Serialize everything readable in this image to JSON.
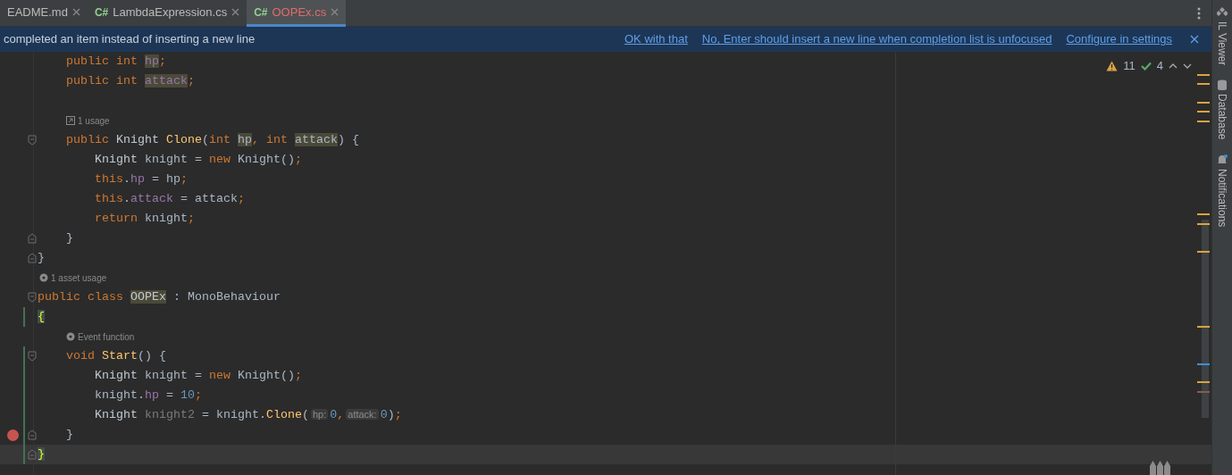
{
  "tabs": [
    {
      "label": "EADME.md",
      "kind": "markdown",
      "selected": false,
      "has_errors": false
    },
    {
      "label": "LambdaExpression.cs",
      "kind": "csharp",
      "icon_text": "C#",
      "selected": false,
      "has_errors": false
    },
    {
      "label": "OOPEx.cs",
      "kind": "csharp",
      "icon_text": "C#",
      "selected": true,
      "has_errors": true
    }
  ],
  "banner": {
    "message": "completed an item instead of inserting a new line",
    "actions": [
      "OK with that",
      "No, Enter should insert a new line when completion list is unfocused",
      "Configure in settings"
    ]
  },
  "inspections": {
    "warnings": "11",
    "passed": "4"
  },
  "editor": {
    "lines": [
      {
        "kind": "code",
        "changed": false,
        "breakpoint": false,
        "current": false,
        "tokens": [
          {
            "t": "    public int ",
            "kind": "kw"
          },
          {
            "t": "hp",
            "kind": "field",
            "hl": true
          },
          {
            "t": ";",
            "kind": "kw"
          }
        ]
      },
      {
        "kind": "code",
        "changed": false,
        "breakpoint": false,
        "current": false,
        "tokens": [
          {
            "t": "    public int ",
            "kind": "kw"
          },
          {
            "t": "attack",
            "kind": "field",
            "hl": true
          },
          {
            "t": ";",
            "kind": "kw"
          }
        ]
      },
      {
        "kind": "blank"
      },
      {
        "kind": "usage-hint",
        "indent": true,
        "text": "1 usage"
      },
      {
        "kind": "fold-start",
        "changed": false,
        "breakpoint": false,
        "current": false,
        "tokens": [
          {
            "t": "    public ",
            "kind": "kw"
          },
          {
            "t": "Knight ",
            "kind": "type"
          },
          {
            "t": "Clone",
            "kind": "method"
          },
          {
            "t": "(",
            "kind": "plain"
          },
          {
            "t": "int ",
            "kind": "kw"
          },
          {
            "t": "hp",
            "kind": "plain",
            "hl": true
          },
          {
            "t": ", ",
            "kind": "kw"
          },
          {
            "t": "int ",
            "kind": "kw"
          },
          {
            "t": "attack",
            "kind": "plain",
            "hl": true
          },
          {
            "t": ") {",
            "kind": "plain"
          }
        ]
      },
      {
        "kind": "code",
        "changed": false,
        "breakpoint": false,
        "current": false,
        "tokens": [
          {
            "t": "        Knight",
            "kind": "type"
          },
          {
            "t": " knight = ",
            "kind": "plain"
          },
          {
            "t": "new",
            "kind": "kw"
          },
          {
            "t": " Knight()",
            "kind": "plain"
          },
          {
            "t": ";",
            "kind": "kw"
          }
        ]
      },
      {
        "kind": "code",
        "changed": false,
        "breakpoint": false,
        "current": false,
        "tokens": [
          {
            "t": "        this",
            "kind": "kw"
          },
          {
            "t": ".",
            "kind": "plain"
          },
          {
            "t": "hp",
            "kind": "field"
          },
          {
            "t": " = hp",
            "kind": "plain"
          },
          {
            "t": ";",
            "kind": "kw"
          }
        ]
      },
      {
        "kind": "code",
        "changed": false,
        "breakpoint": false,
        "current": false,
        "tokens": [
          {
            "t": "        this",
            "kind": "kw"
          },
          {
            "t": ".",
            "kind": "plain"
          },
          {
            "t": "attack",
            "kind": "field"
          },
          {
            "t": " = attack",
            "kind": "plain"
          },
          {
            "t": ";",
            "kind": "kw"
          }
        ]
      },
      {
        "kind": "code",
        "changed": false,
        "breakpoint": false,
        "current": false,
        "tokens": [
          {
            "t": "        return",
            "kind": "kw"
          },
          {
            "t": " knight",
            "kind": "plain"
          },
          {
            "t": ";",
            "kind": "kw"
          }
        ]
      },
      {
        "kind": "fold-end",
        "changed": false,
        "breakpoint": false,
        "current": false,
        "tokens": [
          {
            "t": "    }",
            "kind": "plain"
          }
        ]
      },
      {
        "kind": "fold-end",
        "changed": false,
        "breakpoint": false,
        "current": false,
        "tokens": [
          {
            "t": "}",
            "kind": "plain"
          }
        ]
      },
      {
        "kind": "unity-hint",
        "indent": false,
        "text": "1 asset usage"
      },
      {
        "kind": "fold-start",
        "changed": false,
        "breakpoint": false,
        "current": false,
        "tokens": [
          {
            "t": "public class ",
            "kind": "kw"
          },
          {
            "t": "OOPEx",
            "kind": "type",
            "hl": true
          },
          {
            "t": " : MonoBehaviour",
            "kind": "plain"
          }
        ]
      },
      {
        "kind": "code",
        "changed": true,
        "breakpoint": false,
        "current": false,
        "tokens": [
          {
            "t": "{",
            "kind": "brace"
          }
        ]
      },
      {
        "kind": "unity-hint",
        "indent": true,
        "text": "Event function"
      },
      {
        "kind": "fold-start",
        "changed": true,
        "breakpoint": false,
        "current": false,
        "tokens": [
          {
            "t": "    void ",
            "kind": "kw"
          },
          {
            "t": "Start",
            "kind": "method"
          },
          {
            "t": "() {",
            "kind": "plain"
          }
        ]
      },
      {
        "kind": "code",
        "changed": true,
        "breakpoint": false,
        "current": false,
        "tokens": [
          {
            "t": "        Knight",
            "kind": "type"
          },
          {
            "t": " knight = ",
            "kind": "plain"
          },
          {
            "t": "new",
            "kind": "kw"
          },
          {
            "t": " Knight()",
            "kind": "plain"
          },
          {
            "t": ";",
            "kind": "kw"
          }
        ]
      },
      {
        "kind": "code",
        "changed": true,
        "breakpoint": false,
        "current": false,
        "tokens": [
          {
            "t": "        knight.",
            "kind": "plain"
          },
          {
            "t": "hp",
            "kind": "field"
          },
          {
            "t": " = ",
            "kind": "plain"
          },
          {
            "t": "10",
            "kind": "num"
          },
          {
            "t": ";",
            "kind": "kw"
          }
        ]
      },
      {
        "kind": "code",
        "changed": true,
        "breakpoint": false,
        "current": false,
        "tokens": [
          {
            "t": "        Knight",
            "kind": "type"
          },
          {
            "t": " knight2",
            "kind": "unused"
          },
          {
            "t": " = knight.",
            "kind": "plain"
          },
          {
            "t": "Clone",
            "kind": "method"
          },
          {
            "t": "(",
            "kind": "plain"
          },
          {
            "t": "hp:",
            "kind": "inlay"
          },
          {
            "t": "0",
            "kind": "num"
          },
          {
            "t": ",",
            "kind": "kw"
          },
          {
            "t": "attack:",
            "kind": "inlay"
          },
          {
            "t": "0",
            "kind": "num"
          },
          {
            "t": ")",
            "kind": "plain"
          },
          {
            "t": ";",
            "kind": "kw"
          }
        ]
      },
      {
        "kind": "fold-end",
        "changed": true,
        "breakpoint": true,
        "current": false,
        "tokens": [
          {
            "t": "    }",
            "kind": "plain"
          }
        ]
      },
      {
        "kind": "fold-end",
        "changed": true,
        "breakpoint": false,
        "current": true,
        "tokens": [
          {
            "t": "}",
            "kind": "brace"
          }
        ]
      }
    ]
  },
  "tool_windows": [
    {
      "label": "IL Viewer"
    },
    {
      "label": "Database"
    },
    {
      "label": "Notifications"
    }
  ]
}
